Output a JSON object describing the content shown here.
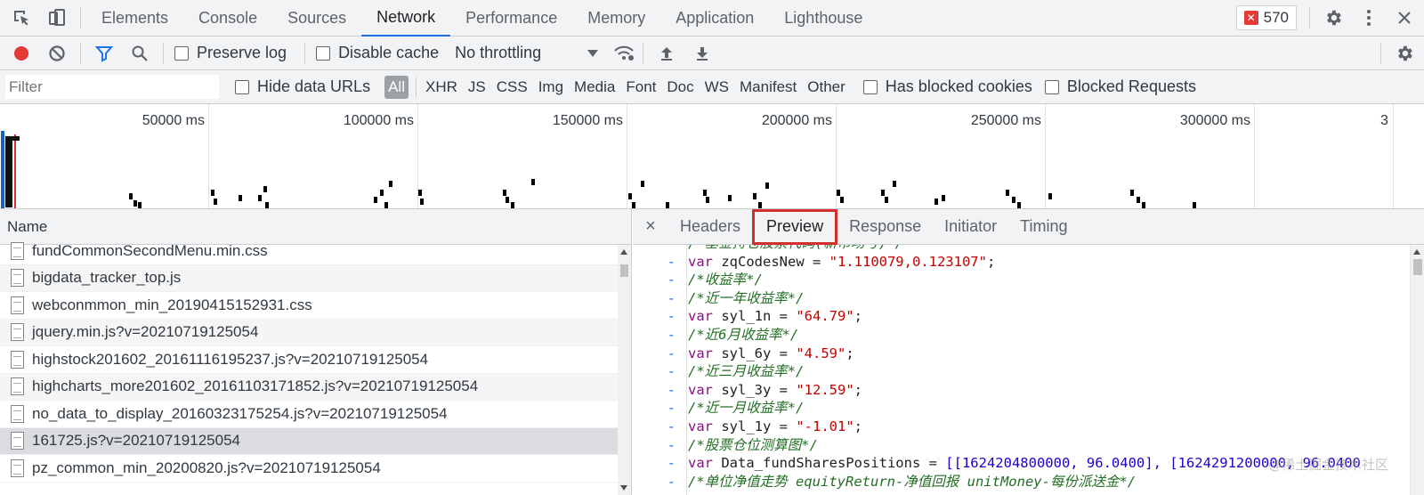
{
  "tabs": [
    "Elements",
    "Console",
    "Sources",
    "Network",
    "Performance",
    "Memory",
    "Application",
    "Lighthouse"
  ],
  "active_tab": "Network",
  "error_count": "570",
  "toolbar": {
    "preserve_log": "Preserve log",
    "disable_cache": "Disable cache",
    "throttling": "No throttling"
  },
  "filter": {
    "placeholder": "Filter",
    "hide_data_urls": "Hide data URLs",
    "types": [
      "All",
      "XHR",
      "JS",
      "CSS",
      "Img",
      "Media",
      "Font",
      "Doc",
      "WS",
      "Manifest",
      "Other"
    ],
    "has_blocked_cookies": "Has blocked cookies",
    "blocked_requests": "Blocked Requests"
  },
  "timeline": {
    "ticks": [
      "50000 ms",
      "100000 ms",
      "150000 ms",
      "200000 ms",
      "250000 ms",
      "300000 ms",
      "3"
    ]
  },
  "request_list": {
    "header": "Name",
    "files": [
      "fundCommonSecondMenu.min.css",
      "bigdata_tracker_top.js",
      "webconmmon_min_20190415152931.css",
      "jquery.min.js?v=20210719125054",
      "highstock201602_20161116195237.js?v=20210719125054",
      "highcharts_more201602_20161103171852.js?v=20210719125054",
      "no_data_to_display_20160323175254.js?v=20210719125054",
      "161725.js?v=20210719125054",
      "pz_common_min_20200820.js?v=20210719125054"
    ],
    "selected_index": 7
  },
  "detail": {
    "close": "×",
    "tabs": [
      "Headers",
      "Preview",
      "Response",
      "Initiator",
      "Timing"
    ],
    "active_tab": "Preview",
    "code_lines": [
      {
        "type": "comment",
        "text": "/*基金持仓股票代码(新市场号)*/"
      },
      {
        "type": "var",
        "name": "zqCodesNew",
        "value": "\"1.110079,0.123107\""
      },
      {
        "type": "comment",
        "text": "/*收益率*/"
      },
      {
        "type": "comment",
        "text": "/*近一年收益率*/"
      },
      {
        "type": "var",
        "name": "syl_1n",
        "value": "\"64.79\""
      },
      {
        "type": "comment",
        "text": "/*近6月收益率*/"
      },
      {
        "type": "var",
        "name": "syl_6y",
        "value": "\"4.59\""
      },
      {
        "type": "comment",
        "text": "/*近三月收益率*/"
      },
      {
        "type": "var",
        "name": "syl_3y",
        "value": "\"12.59\""
      },
      {
        "type": "comment",
        "text": "/*近一月收益率*/"
      },
      {
        "type": "var",
        "name": "syl_1y",
        "value": "\"-1.01\""
      },
      {
        "type": "comment",
        "text": "/*股票仓位测算图*/"
      },
      {
        "type": "array",
        "name": "Data_fundSharesPositions",
        "value": "[[1624204800000, 96.0400], [1624291200000, 96.0400"
      },
      {
        "type": "comment",
        "text": "/*单位净值走势 equityReturn-净值回报 unitMoney-每份派送金*/"
      }
    ],
    "gutter_symbol": "-",
    "watermark": "@稀土掘金技术社区"
  },
  "colors": {
    "accent": "#1a73e8",
    "record": "#e53935",
    "highlight_border": "#d32f2f"
  }
}
